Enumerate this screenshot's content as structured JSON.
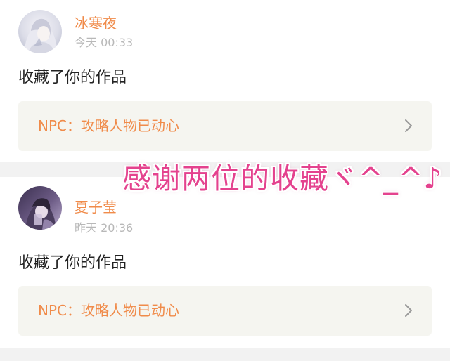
{
  "notifications": [
    {
      "username": "冰寒夜",
      "timestamp": "今天 00:33",
      "action": "收藏了你的作品",
      "work_title": "NPC：攻略人物已动心",
      "chevron_icon": "chevron-right-icon"
    },
    {
      "username": "夏子莹",
      "timestamp": "昨天 20:36",
      "action": "收藏了你的作品",
      "work_title": "NPC：攻略人物已动心",
      "chevron_icon": "chevron-right-icon"
    }
  ],
  "overlay": {
    "text": "感谢两位的收藏ヾ^_^♪"
  },
  "colors": {
    "username": "#f08b4a",
    "timestamp": "#b8b8b8",
    "work_title": "#f08b4a",
    "work_bg": "#f5f5f0",
    "divider": "#f2f2f2",
    "overlay_text": "#e4428e"
  }
}
